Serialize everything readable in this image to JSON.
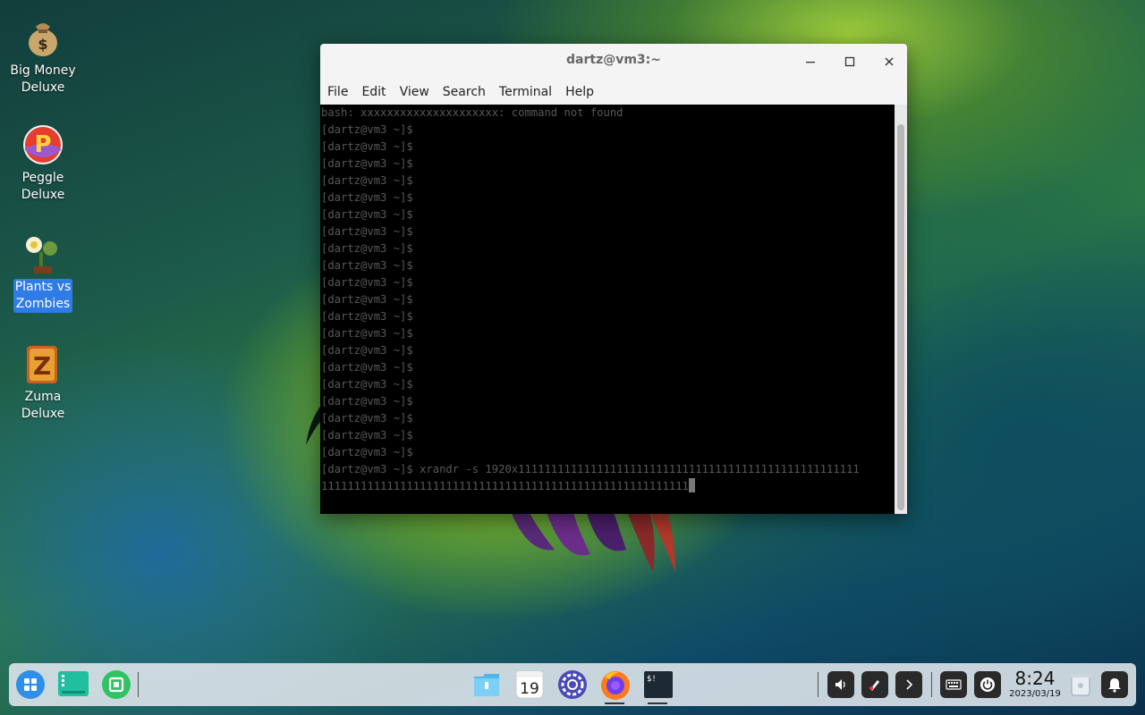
{
  "desktop": {
    "icons": [
      {
        "label_line1": "Big Money",
        "label_line2": "Deluxe"
      },
      {
        "label_line1": "Peggle",
        "label_line2": "Deluxe"
      },
      {
        "label_line1": "Plants vs",
        "label_line2": "Zombies"
      },
      {
        "label_line1": "Zuma",
        "label_line2": "Deluxe"
      }
    ]
  },
  "window": {
    "title": "dartz@vm3:~",
    "menu": [
      "File",
      "Edit",
      "View",
      "Search",
      "Terminal",
      "Help"
    ]
  },
  "terminal": {
    "lines": [
      "bash: xxxxxxxxxxxxxxxxxxxxx: command not found",
      "[dartz@vm3 ~]$",
      "[dartz@vm3 ~]$",
      "[dartz@vm3 ~]$",
      "[dartz@vm3 ~]$",
      "[dartz@vm3 ~]$",
      "[dartz@vm3 ~]$",
      "[dartz@vm3 ~]$",
      "[dartz@vm3 ~]$",
      "[dartz@vm3 ~]$",
      "[dartz@vm3 ~]$",
      "[dartz@vm3 ~]$",
      "[dartz@vm3 ~]$",
      "[dartz@vm3 ~]$",
      "[dartz@vm3 ~]$",
      "[dartz@vm3 ~]$",
      "[dartz@vm3 ~]$",
      "[dartz@vm3 ~]$",
      "[dartz@vm3 ~]$",
      "[dartz@vm3 ~]$",
      "[dartz@vm3 ~]$",
      "[dartz@vm3 ~]$ xrandr -s 1920x1111111111111111111111111111111111111111111111111111",
      "11111111111111111111111111111111111111111111111111111111"
    ]
  },
  "taskbar": {
    "calendar_day": "19",
    "clock_time": "8:24",
    "clock_date": "2023/03/19",
    "terminal_glyph": "$!"
  }
}
